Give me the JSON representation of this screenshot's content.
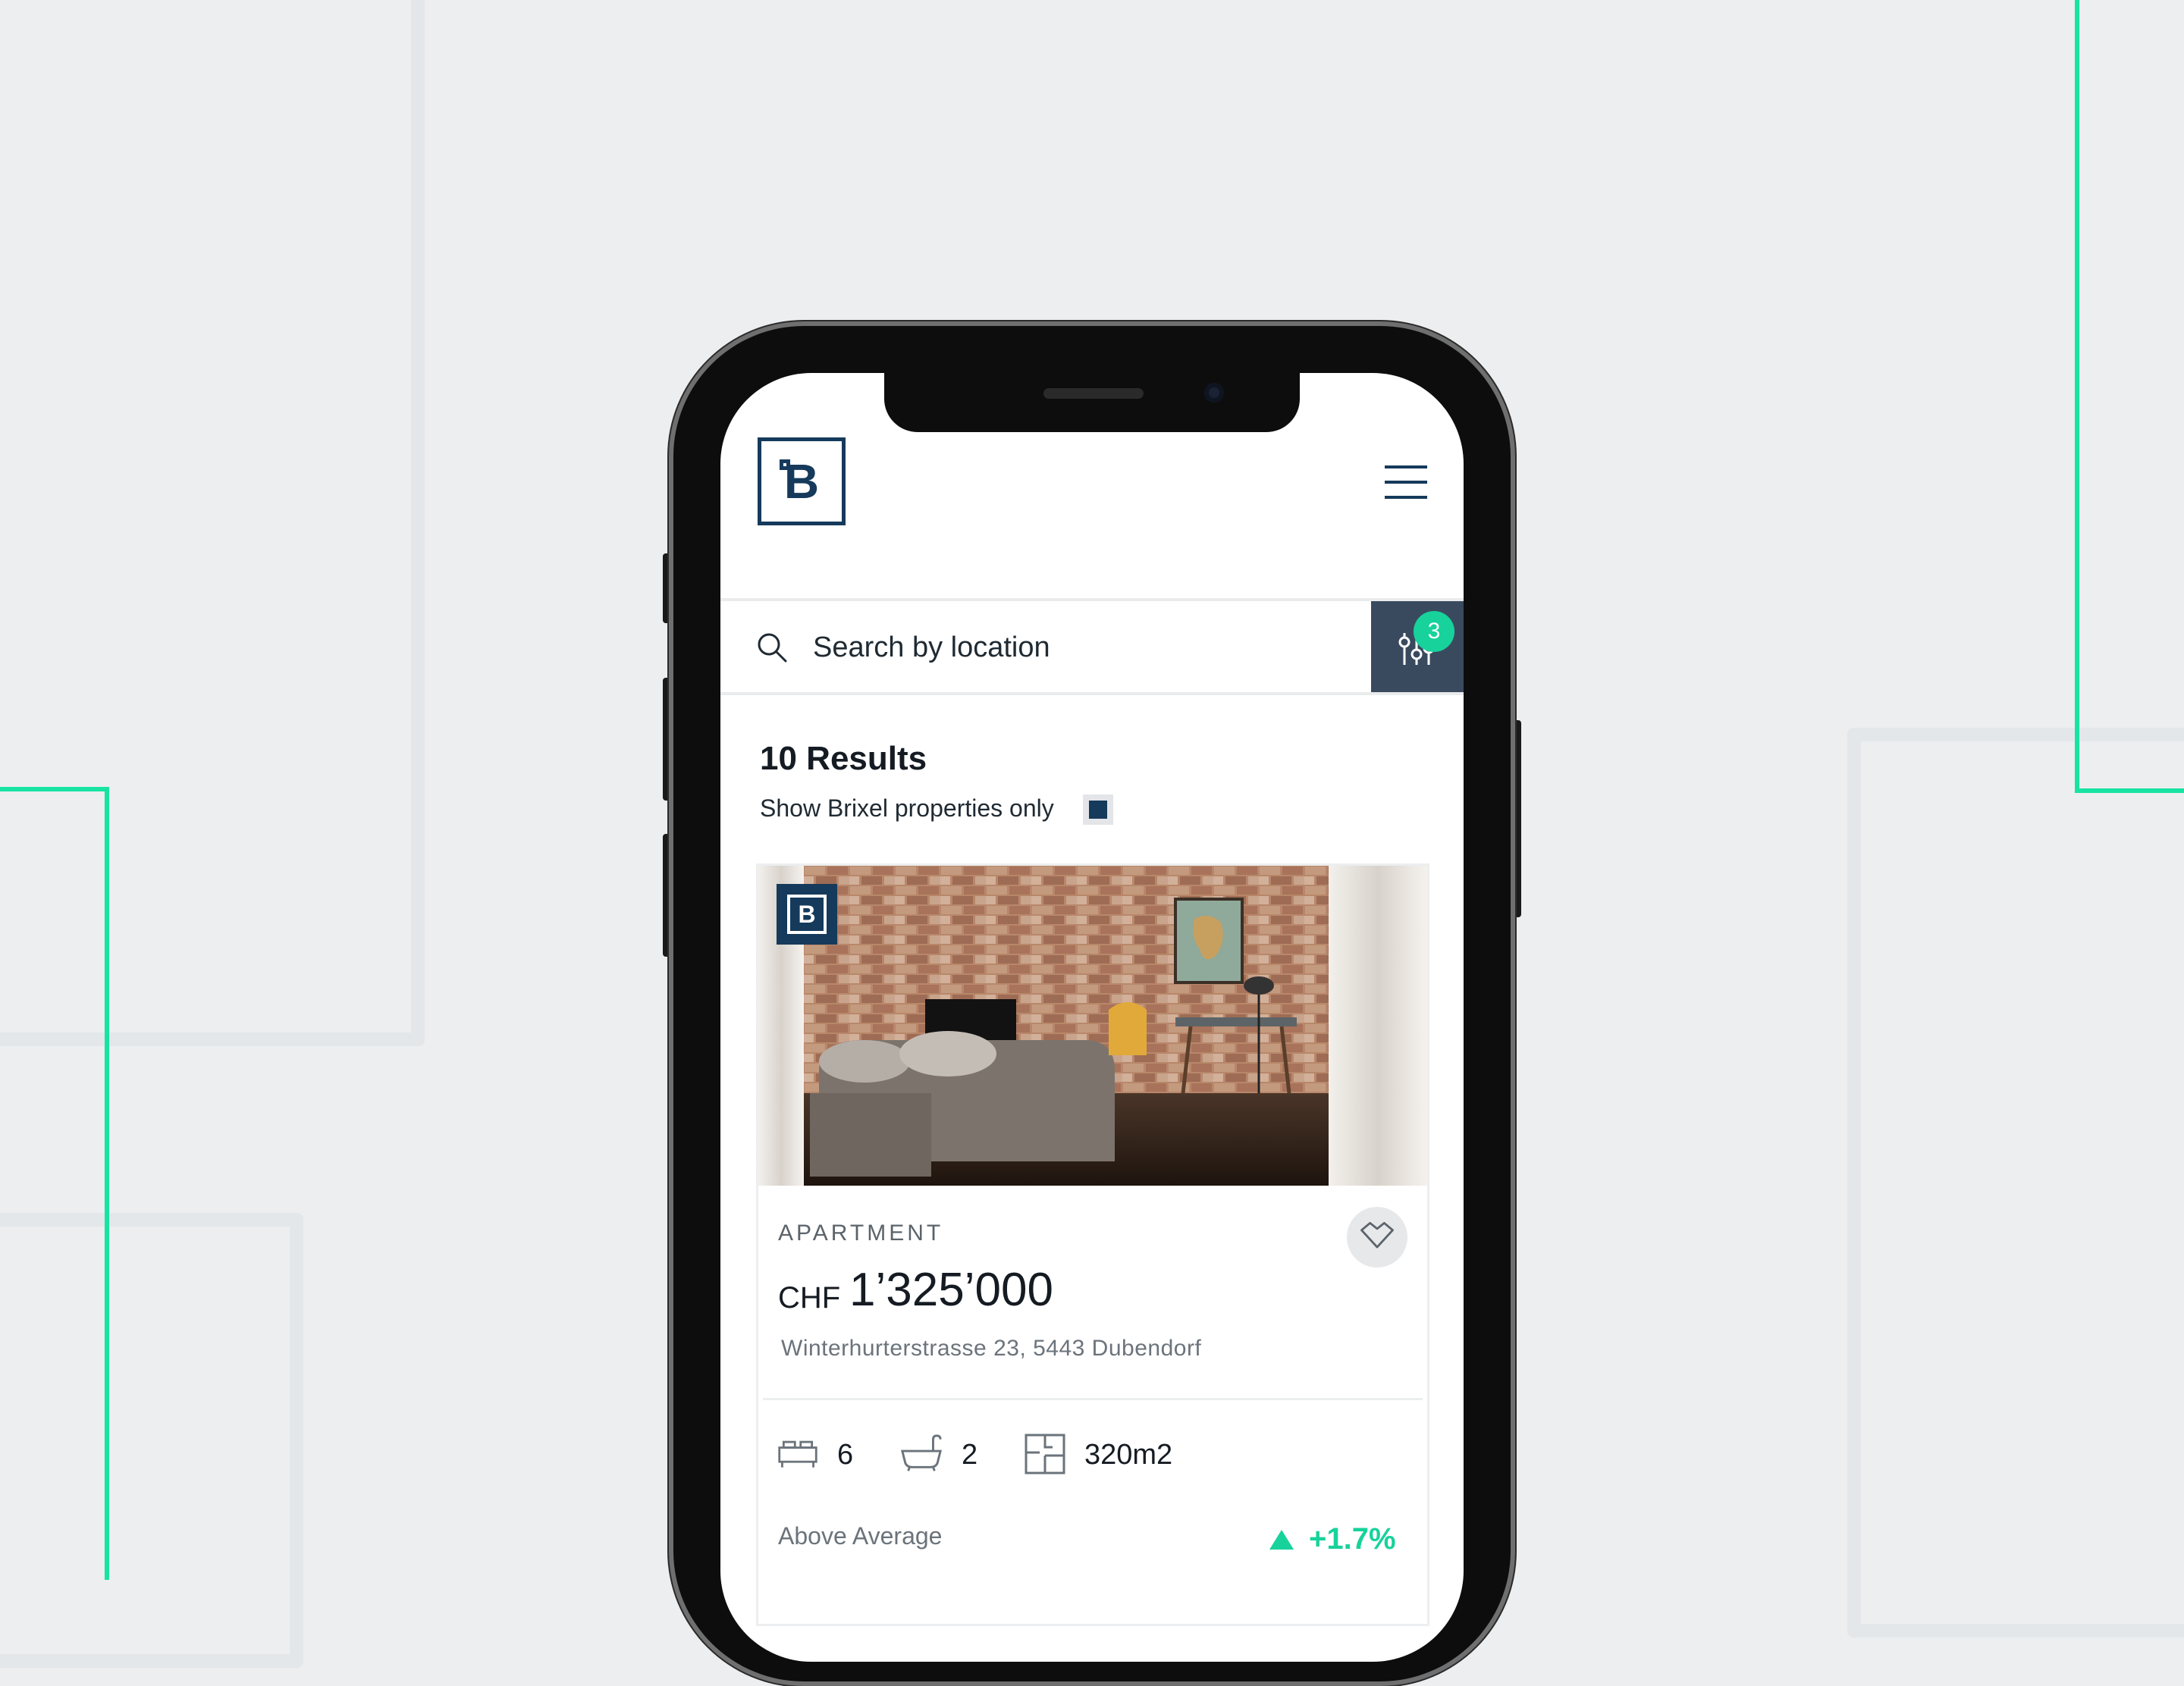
{
  "colors": {
    "brand": "#153a5b",
    "accent": "#17d29b",
    "background": "#eceef0"
  },
  "header": {
    "logo_letter": "B",
    "menu_icon": "hamburger-menu-icon"
  },
  "search": {
    "placeholder": "Search by location",
    "filter_badge": "3"
  },
  "results": {
    "title": "10 Results",
    "brixel_only_label": "Show Brixel properties only",
    "brixel_only_checked": true
  },
  "listing": {
    "badge_letter": "B",
    "type": "APARTMENT",
    "currency": "CHF",
    "price": "1’325’000",
    "address": "Winterhurterstrasse 23, 5443 Dubendorf",
    "bedrooms": "6",
    "bathrooms": "2",
    "area": "320m2",
    "market_label": "Above Average",
    "market_change": "+1.7%"
  }
}
